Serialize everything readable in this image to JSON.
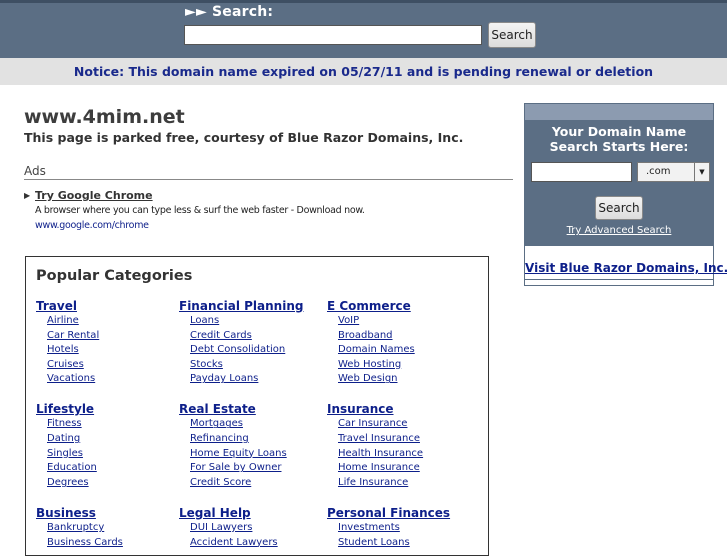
{
  "top_search": {
    "label": "►► Search:",
    "input_value": "",
    "button_label": "Search"
  },
  "notice": "Notice: This domain name expired on 05/27/11 and is pending renewal or deletion",
  "domain": {
    "title": "www.4mim.net",
    "parked_text": "This page is parked free, courtesy of Blue Razor Domains, Inc."
  },
  "ads": {
    "heading": "Ads",
    "items": [
      {
        "title": "Try Google Chrome",
        "description": "A browser where you can type less & surf the web faster - Download now.",
        "url": "www.google.com/chrome"
      }
    ]
  },
  "categories": {
    "heading": "Popular Categories",
    "columns": [
      [
        {
          "title": "Travel",
          "links": [
            "Airline",
            "Car Rental",
            "Hotels",
            "Cruises",
            "Vacations"
          ]
        },
        {
          "title": "Lifestyle",
          "links": [
            "Fitness",
            "Dating",
            "Singles",
            "Education",
            "Degrees"
          ]
        },
        {
          "title": "Business",
          "links": [
            "Bankruptcy",
            "Business Cards"
          ]
        }
      ],
      [
        {
          "title": "Financial Planning",
          "links": [
            "Loans",
            "Credit Cards",
            "Debt Consolidation",
            "Stocks",
            "Payday Loans"
          ]
        },
        {
          "title": "Real Estate",
          "links": [
            "Mortgages",
            "Refinancing",
            "Home Equity Loans",
            "For Sale by Owner",
            "Credit Score"
          ]
        },
        {
          "title": "Legal Help",
          "links": [
            "DUI Lawyers",
            "Accident Lawyers"
          ]
        }
      ],
      [
        {
          "title": "E Commerce",
          "links": [
            "VoIP",
            "Broadband",
            "Domain Names",
            "Web Hosting",
            "Web Design"
          ]
        },
        {
          "title": "Insurance",
          "links": [
            "Car Insurance",
            "Travel Insurance",
            "Health Insurance",
            "Home Insurance",
            "Life Insurance"
          ]
        },
        {
          "title": "Personal Finances",
          "links": [
            "Investments",
            "Student Loans"
          ]
        }
      ]
    ]
  },
  "sidebar": {
    "heading_line1": "Your Domain Name",
    "heading_line2": "Search Starts Here:",
    "input_value": "",
    "tld_selected": ".com",
    "button_label": "Search",
    "advanced_link": "Try Advanced Search",
    "visit_link": "Visit Blue Razor Domains, Inc."
  }
}
